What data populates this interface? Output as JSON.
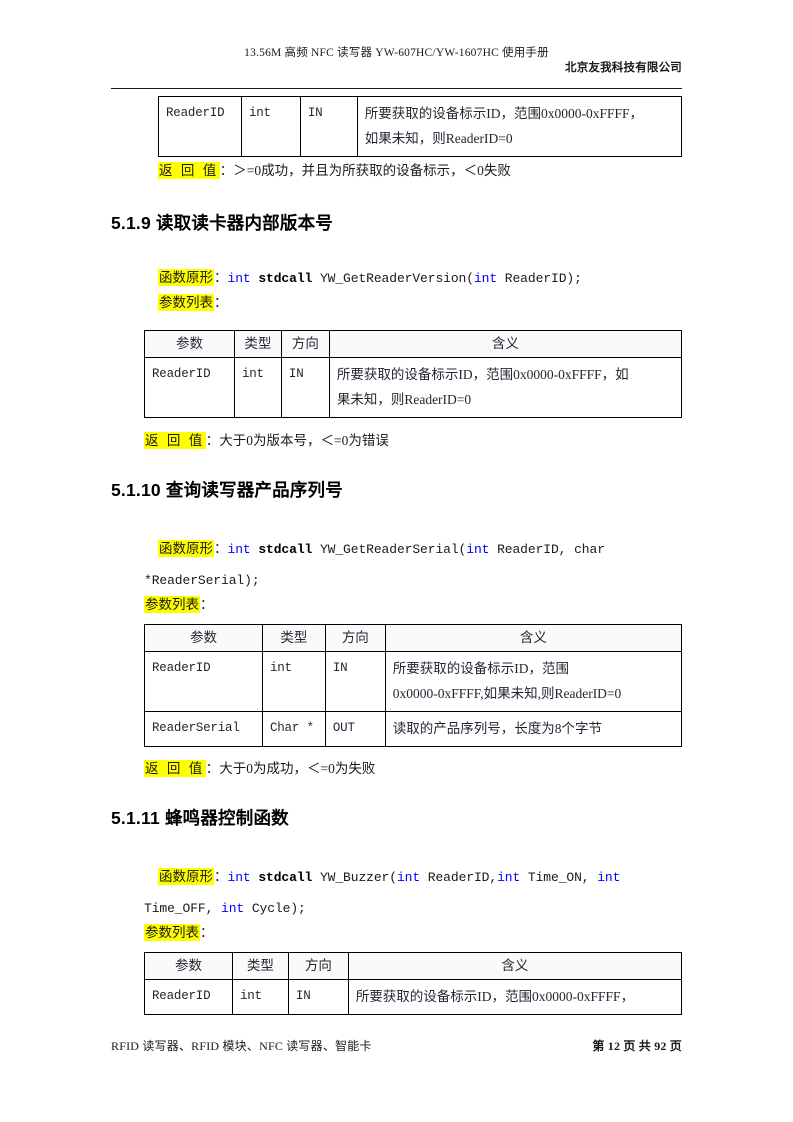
{
  "header": {
    "title": "13.56M  高频 NFC 读写器 YW-607HC/YW-1607HC 使用手册",
    "company": "北京友我科技有限公司"
  },
  "footer": {
    "left": "RFID 读写器、RFID 模块、NFC 读写器、智能卡",
    "right": "第 12 页 共 92 页"
  },
  "colors": {
    "highlight": "#ffff00",
    "keyword": "#0000ff",
    "text": "#1a1a1a",
    "border": "#000000"
  },
  "labels": {
    "param_list": "参数列表",
    "colon": "：",
    "prototype": "函数原形",
    "return_value": "返 回 值"
  },
  "table_headers": [
    "参数",
    "类型",
    "方向",
    "含义"
  ],
  "table1": {
    "rows": [
      {
        "param": "ReaderID",
        "type": "int",
        "dir": "IN",
        "meaning_line1": "所要获取的设备标示ID，范围0x0000-0xFFFF，",
        "meaning_line2": "如果未知，则ReaderID=0"
      }
    ],
    "return_text": "＞=0成功，并且为所获取的设备标示，＜0失败"
  },
  "section_5_1_9": {
    "heading": "5.1.9 读取读卡器内部版本号",
    "prototype": {
      "pre": "int",
      "call": "stdcall",
      "name": "YW_GetReaderVersion(",
      "arg_type": "int",
      "arg_name": " ReaderID);"
    },
    "table": {
      "rows": [
        {
          "param": "ReaderID",
          "type": "int",
          "dir": "IN",
          "meaning_line1": "所要获取的设备标示ID，范围0x0000-0xFFFF，如",
          "meaning_line2": "果未知，则ReaderID=0"
        }
      ]
    },
    "return_text": "大于0为版本号，＜=0为错误"
  },
  "section_5_1_10": {
    "heading": "5.1.10 查询读写器产品序列号",
    "prototype": {
      "pre": "int",
      "call": "stdcall",
      "name": "YW_GetReaderSerial(",
      "arg_type": "int",
      "arg_name": " ReaderID, char",
      "line2": "*ReaderSerial);"
    },
    "table": {
      "rows": [
        {
          "param": "ReaderID",
          "type": "int",
          "dir": "IN",
          "meaning_line1": "所要获取的设备标示ID，范围",
          "meaning_line2": "0x0000-0xFFFF,如果未知,则ReaderID=0"
        },
        {
          "param": "ReaderSerial",
          "type": "Char *",
          "dir": "OUT",
          "meaning_line1": "读取的产品序列号，长度为8个字节",
          "meaning_line2": ""
        }
      ]
    },
    "return_text": "大于0为成功，＜=0为失败"
  },
  "section_5_1_11": {
    "heading": "5.1.11 蜂鸣器控制函数",
    "prototype": {
      "pre": "int",
      "call": "stdcall",
      "name": "YW_Buzzer(",
      "arg_type": "int",
      "arg_name": " ReaderID,",
      "arg_type2": "int",
      "arg_name2": " Time_ON,  ",
      "arg_type3": "int",
      "line2_a": "Time_OFF,  ",
      "line2_kw": "int",
      "line2_b": " Cycle);"
    },
    "table": {
      "rows": [
        {
          "param": "ReaderID",
          "type": "int",
          "dir": "IN",
          "meaning_line1": "所要获取的设备标示ID，范围0x0000-0xFFFF，",
          "meaning_line2": ""
        }
      ]
    }
  }
}
